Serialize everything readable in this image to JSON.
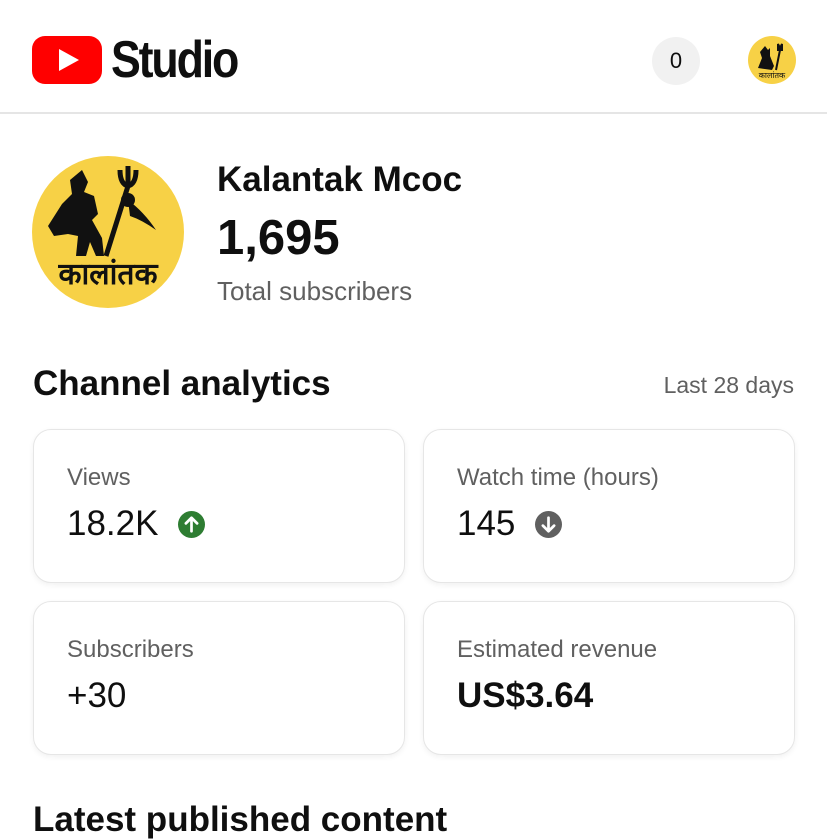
{
  "header": {
    "brand": "Studio",
    "notification_count": "0"
  },
  "channel": {
    "name": "Kalantak Mcoc",
    "subscribers": "1,695",
    "subscribers_label": "Total subscribers",
    "avatar_text": "कालांतक"
  },
  "analytics": {
    "title": "Channel analytics",
    "range": "Last 28 days",
    "cards": [
      {
        "label": "Views",
        "value": "18.2K",
        "trend": "up"
      },
      {
        "label": "Watch time (hours)",
        "value": "145",
        "trend": "down"
      },
      {
        "label": "Subscribers",
        "value": "+30"
      },
      {
        "label": "Estimated revenue",
        "value": "US$3.64"
      }
    ]
  },
  "latest": {
    "title": "Latest published content"
  },
  "colors": {
    "youtube_red": "#ff0000",
    "trend_up": "#2e7d32",
    "trend_down": "#606060",
    "avatar_yellow": "#f7d146"
  },
  "icons": {
    "logo": "youtube-play-icon",
    "trend_up": "arrow-up-circle-icon",
    "trend_down": "arrow-down-circle-icon"
  }
}
